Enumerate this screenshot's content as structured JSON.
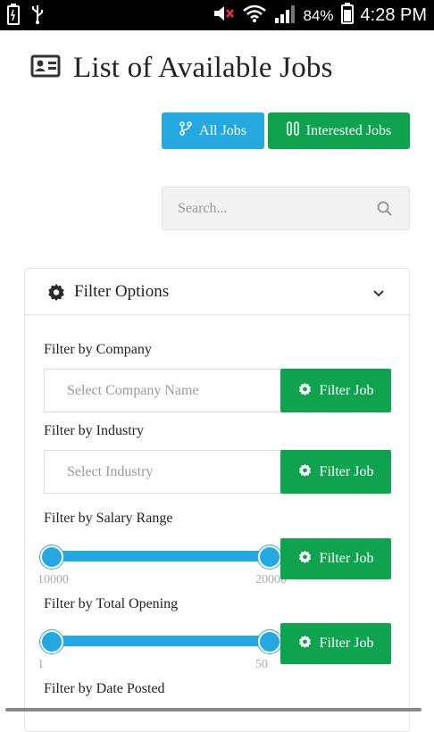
{
  "status_bar": {
    "battery": "84%",
    "time": "4:28 PM"
  },
  "page": {
    "title": "List of Available Jobs"
  },
  "toolbar": {
    "all_jobs": "All Jobs",
    "interested_jobs": "Interested Jobs"
  },
  "search": {
    "placeholder": "Search..."
  },
  "filter": {
    "title": "Filter Options",
    "company": {
      "label": "Filter by Company",
      "placeholder": "Select Company Name",
      "button": "Filter Job"
    },
    "industry": {
      "label": "Filter by Industry",
      "placeholder": "Select Industry",
      "button": "Filter Job"
    },
    "salary": {
      "label": "Filter by Salary Range",
      "min": "10000",
      "max": "20000",
      "button": "Filter Job"
    },
    "opening": {
      "label": "Filter by Total Opening",
      "min": "1",
      "max": "50",
      "button": "Filter Job"
    },
    "date": {
      "label": "Filter by Date Posted"
    }
  }
}
